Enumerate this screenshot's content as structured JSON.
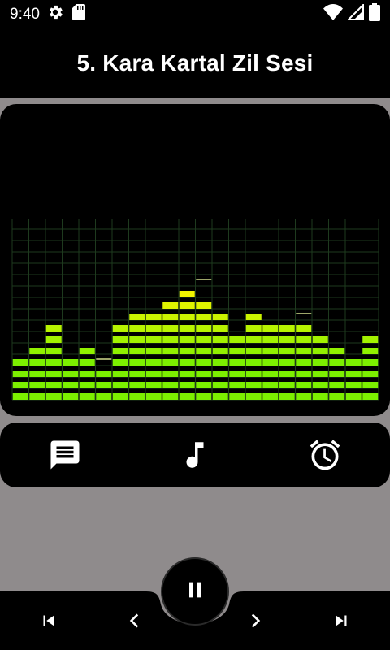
{
  "status_bar": {
    "time": "9:40",
    "left_icons": [
      "settings-icon",
      "sd-card-icon"
    ],
    "right_icons": [
      "wifi-icon",
      "signal-icon",
      "battery-icon"
    ]
  },
  "header": {
    "title": "5. Kara Kartal Zil Sesi"
  },
  "visualizer": {
    "levels": [
      4,
      5,
      7,
      4,
      5,
      3,
      7,
      8,
      8,
      9,
      10,
      9,
      8,
      6,
      8,
      7,
      7,
      7,
      6,
      5,
      4,
      6
    ],
    "peaks": [
      4,
      5,
      7,
      4,
      5,
      4,
      7,
      8,
      8,
      9,
      10,
      11,
      8,
      6,
      8,
      7,
      7,
      8,
      6,
      5,
      4,
      6
    ],
    "colors": {
      "low": "#7cf000",
      "high": "#f2f500",
      "peak_cap": "#9ea66a",
      "grid": "#1e3a1e"
    }
  },
  "actions": {
    "items": [
      "message-icon",
      "music-note-icon",
      "alarm-icon"
    ]
  },
  "player": {
    "state_icon": "pause-icon",
    "controls": [
      "skip-previous-icon",
      "previous-icon",
      "next-icon",
      "skip-next-icon"
    ]
  }
}
